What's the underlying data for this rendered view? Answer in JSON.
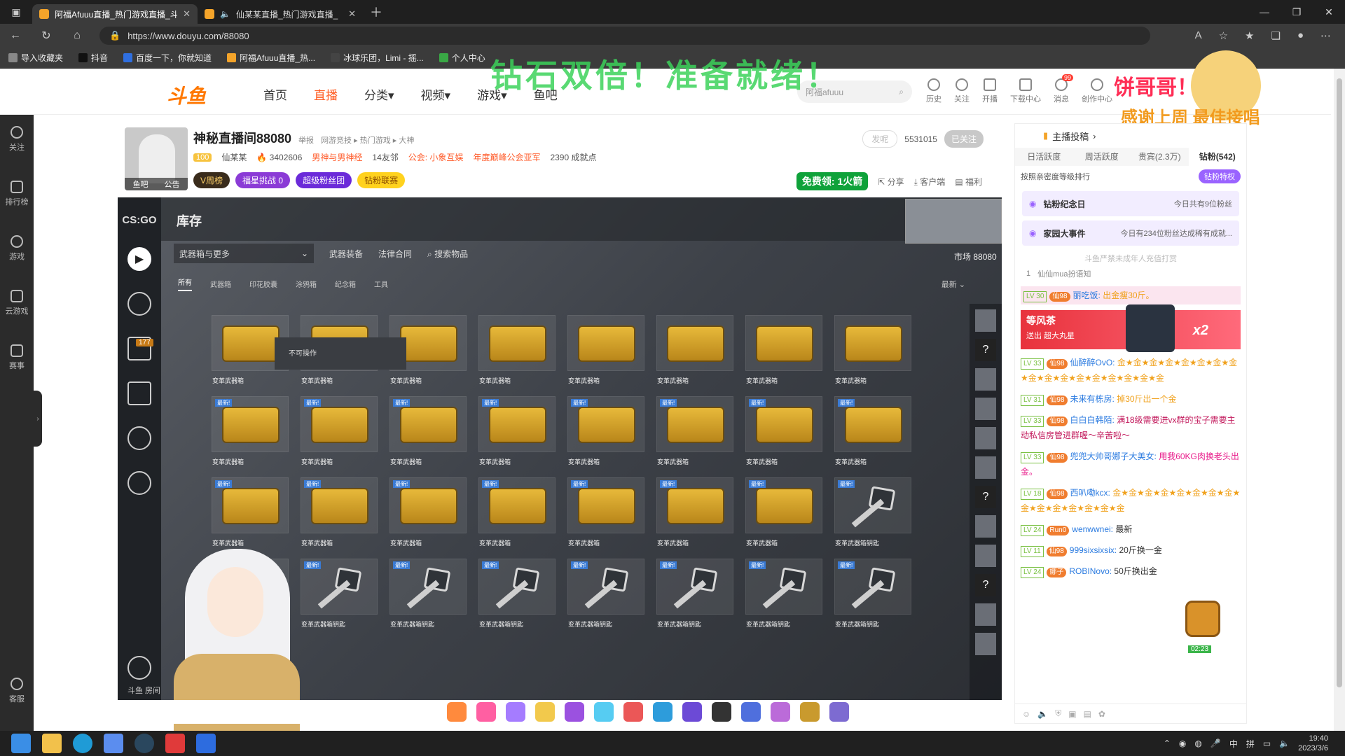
{
  "browser": {
    "tabs": [
      {
        "title": "阿福Afuuu直播_热门游戏直播_斗",
        "active": true
      },
      {
        "title": "仙某某直播_热门游戏直播_",
        "active": false
      }
    ],
    "url": "https://www.douyu.com/88080",
    "bookmarks": [
      "导入收藏夹",
      "抖音",
      "百度一下，你就知道",
      "阿福Afuuu直播_热...",
      "冰球乐团，Limi - 摇...",
      "个人中心"
    ]
  },
  "site": {
    "logo": "斗鱼",
    "nav": [
      "首页",
      "直播",
      "分类",
      "视频",
      "游戏",
      "鱼吧"
    ],
    "active_nav": "直播",
    "banner": "钻石双倍！准备就绪！",
    "search_placeholder": "阿福afuuu",
    "tools": [
      {
        "label": "历史"
      },
      {
        "label": "关注"
      },
      {
        "label": "开播"
      },
      {
        "label": "下载中心"
      },
      {
        "label": "消息",
        "badge": "99"
      },
      {
        "label": "创作中心"
      }
    ],
    "mascot_text_1": "饼哥哥！",
    "mascot_text_2": "感谢上周 最佳接唱君"
  },
  "sidebar": [
    "关注",
    "排行榜",
    "游戏",
    "云游戏",
    "赛事",
    "客服"
  ],
  "room": {
    "title": "神秘直播间88080",
    "report": "举报",
    "category": [
      "网游竞技",
      "热门游戏",
      "大神"
    ],
    "level": "100",
    "anchor": "仙某某",
    "hot": "3402606",
    "tag": "男神与男神经",
    "neighbors": "14友邻",
    "guild": "公会: 小象互娱",
    "guild_award": "年度巅峰公会亚军",
    "achievements": "2390 成就点",
    "pills": [
      "V周榜",
      "福星挑战",
      "超级粉丝团",
      "钻粉联赛"
    ],
    "challenge_count": "0",
    "avatar_tags": [
      "鱼吧",
      "公告"
    ],
    "follow_btn": "发呢",
    "followers": "5531015",
    "followed_btn": "已关注",
    "free_btn": "免费领: 1火箭",
    "actions": [
      "分享",
      "客户端",
      "福利"
    ]
  },
  "game": {
    "logo": "CS:GO",
    "title": "库存",
    "select": "武器箱与更多",
    "toolbar": [
      "武器装备",
      "法律合同",
      "搜索物品"
    ],
    "filters": [
      "所有",
      "武器箱",
      "印花胶囊",
      "涂鸦箱",
      "纪念箱",
      "工具"
    ],
    "sort": "最新",
    "market": "市场",
    "room_num": "88080",
    "badge": "177",
    "tooltip": "不可操作",
    "new_tag": "最新!",
    "case_label": "变革武器箱",
    "key_label": "变革武器箱钥匙",
    "footer": "斗鱼 房间",
    "rows": [
      [
        "case",
        "case",
        "case",
        "case",
        "case",
        "case",
        "case",
        "case"
      ],
      [
        "case",
        "case",
        "case",
        "case",
        "case",
        "case",
        "case",
        "case"
      ],
      [
        "case",
        "case",
        "case",
        "case",
        "case",
        "case",
        "case",
        "key"
      ],
      [
        "key",
        "key",
        "key",
        "key",
        "key",
        "key",
        "key",
        "key"
      ]
    ]
  },
  "panel": {
    "head": "主播投稿",
    "tabs": [
      "日活跃度",
      "周活跃度",
      "贵宾(2.3万)",
      "钻粉(542)"
    ],
    "sort_label": "按照亲密度等级排行",
    "vip_btn": "钻粉特权",
    "card1_title": "钻粉纪念日",
    "card1_right": "今日共有9位粉丝",
    "card2_title": "家园大事件",
    "card2_right": "今日有234位粉丝达成稀有成就...",
    "notice": "斗鱼严禁未成年人充值打赏",
    "rank_user": "仙仙mua扮语知",
    "rank_no": "1",
    "banner_name": "等风茶",
    "banner_sub": "送出  超大丸星",
    "banner_x": "x2",
    "messages": [
      {
        "lv": "LV 30",
        "fan": "仙98",
        "user": "丽吃饭:",
        "text": "出金瘦30斤。"
      },
      {
        "lv": "LV 33",
        "fan": "仙98",
        "user": "仙醉醉OvO:",
        "text": "金★金★金★金★金★金★金★金★金★金★金★金★金★金★金★金★金"
      },
      {
        "lv": "LV 31",
        "fan": "仙98",
        "user": "未来有栋房:",
        "text": "掉30斤出一个金"
      },
      {
        "lv": "LV 33",
        "fan": "仙98",
        "user": "白白白韩陌:",
        "text": "满18级需要进vx群的宝子需要主动私信房管进群喔～辛苦啦～"
      },
      {
        "lv": "LV 33",
        "fan": "仙98",
        "user": "兜兜大帅哥娜子大美女:",
        "text": "用我60KG肉换老头出金。"
      },
      {
        "lv": "LV 18",
        "fan": "仙98",
        "user": "西叭嘞kcx:",
        "text": "金★金★金★金★金★金★金★金★金★金★金★金★金★金★金"
      },
      {
        "lv": "LV 24",
        "fan": "Run0",
        "user": "wenwwnei:",
        "text": "最新"
      },
      {
        "lv": "LV 11",
        "fan": "仙98",
        "user": "999sixsixsix:",
        "text": "20斤换一金"
      },
      {
        "lv": "LV 24",
        "fan": "娜子",
        "user": "ROBINovo:",
        "text": "50斤换出金"
      }
    ],
    "chest_timer": "02:23"
  },
  "taskbar": {
    "time": "19:40",
    "date": "2023/3/6",
    "ime": [
      "中",
      "拼"
    ]
  }
}
